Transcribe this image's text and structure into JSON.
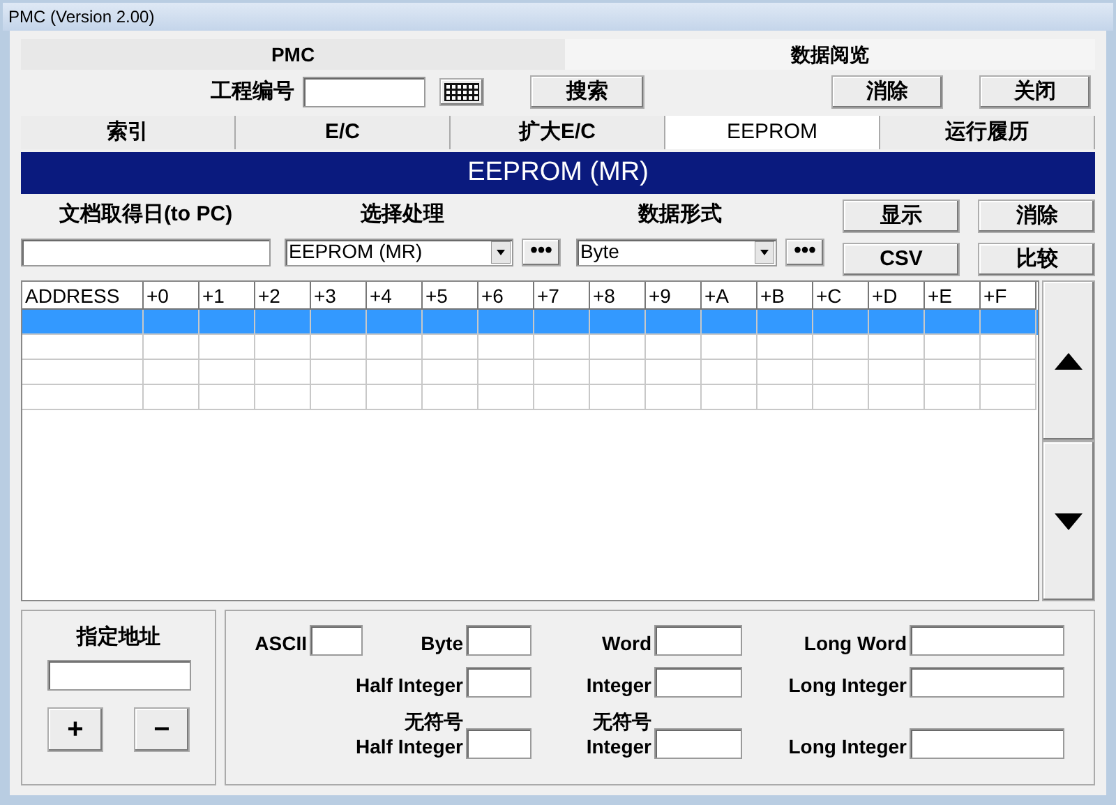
{
  "window": {
    "title": "PMC (Version 2.00)"
  },
  "header": {
    "left_title": "PMC",
    "right_title": "数据阅览",
    "project_label": "工程编号",
    "search_button": "搜索",
    "clear_button": "消除",
    "close_button": "关闭"
  },
  "tabs": [
    {
      "label": "索引",
      "selected": false
    },
    {
      "label": "E/C",
      "selected": false
    },
    {
      "label": "扩大E/C",
      "selected": false
    },
    {
      "label": "EEPROM",
      "selected": true
    },
    {
      "label": "运行履历",
      "selected": false
    }
  ],
  "banner": "EEPROM (MR)",
  "form": {
    "date_label": "文档取得日(to PC)",
    "select_label": "选择处理",
    "select_value": "EEPROM (MR)",
    "format_label": "数据形式",
    "format_value": "Byte",
    "more_button": "•••",
    "buttons": [
      "显示",
      "消除",
      "CSV",
      "比较"
    ]
  },
  "table": {
    "columns": [
      "ADDRESS",
      "+0",
      "+1",
      "+2",
      "+3",
      "+4",
      "+5",
      "+6",
      "+7",
      "+8",
      "+9",
      "+A",
      "+B",
      "+C",
      "+D",
      "+E",
      "+F"
    ],
    "rows": [
      {
        "selected": true
      },
      {
        "selected": false
      },
      {
        "selected": false
      },
      {
        "selected": false
      }
    ]
  },
  "address_panel": {
    "label": "指定地址",
    "plus_button": "+",
    "minus_button": "−"
  },
  "value_fields": [
    [
      {
        "label": "ASCII"
      },
      {
        "label": "Byte"
      },
      {
        "label": "Word"
      },
      {
        "label": "Long Word"
      }
    ],
    [
      {
        "label": "Half Integer"
      },
      {
        "label": "Integer"
      },
      {
        "label": "Long Integer"
      }
    ],
    [
      {
        "label": "无符号",
        "label_2": "Half Integer"
      },
      {
        "label": "无符号",
        "label_2": "Integer"
      },
      {
        "label": "Long Integer"
      }
    ]
  ]
}
